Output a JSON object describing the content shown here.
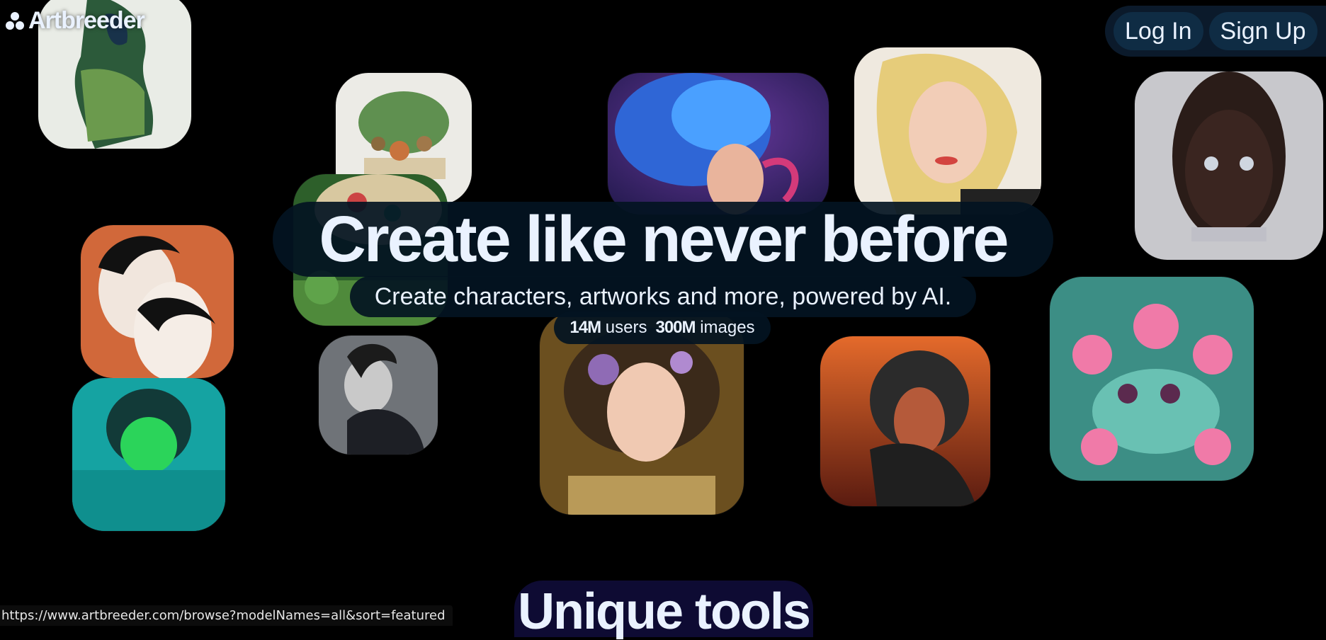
{
  "brand": {
    "name": "Artbreeder",
    "icon": "artbreeder-logo-icon"
  },
  "auth": {
    "login_label": "Log In",
    "signup_label": "Sign Up"
  },
  "hero": {
    "title": "Create like never before",
    "subtitle": "Create characters, artworks and more, powered by AI.",
    "stats": [
      {
        "value": "14M",
        "label": "users"
      },
      {
        "value": "300M",
        "label": "images"
      }
    ]
  },
  "section": {
    "title": "Unique tools"
  },
  "status_bar": {
    "url": "https://www.artbreeder.com/browse?modelNames=all&sort=featured"
  },
  "colors": {
    "background": "#000000",
    "pill": "#031422",
    "button": "#0f2c44",
    "heading": "#eaf2ff",
    "tools_bg": "#0e0b33"
  }
}
